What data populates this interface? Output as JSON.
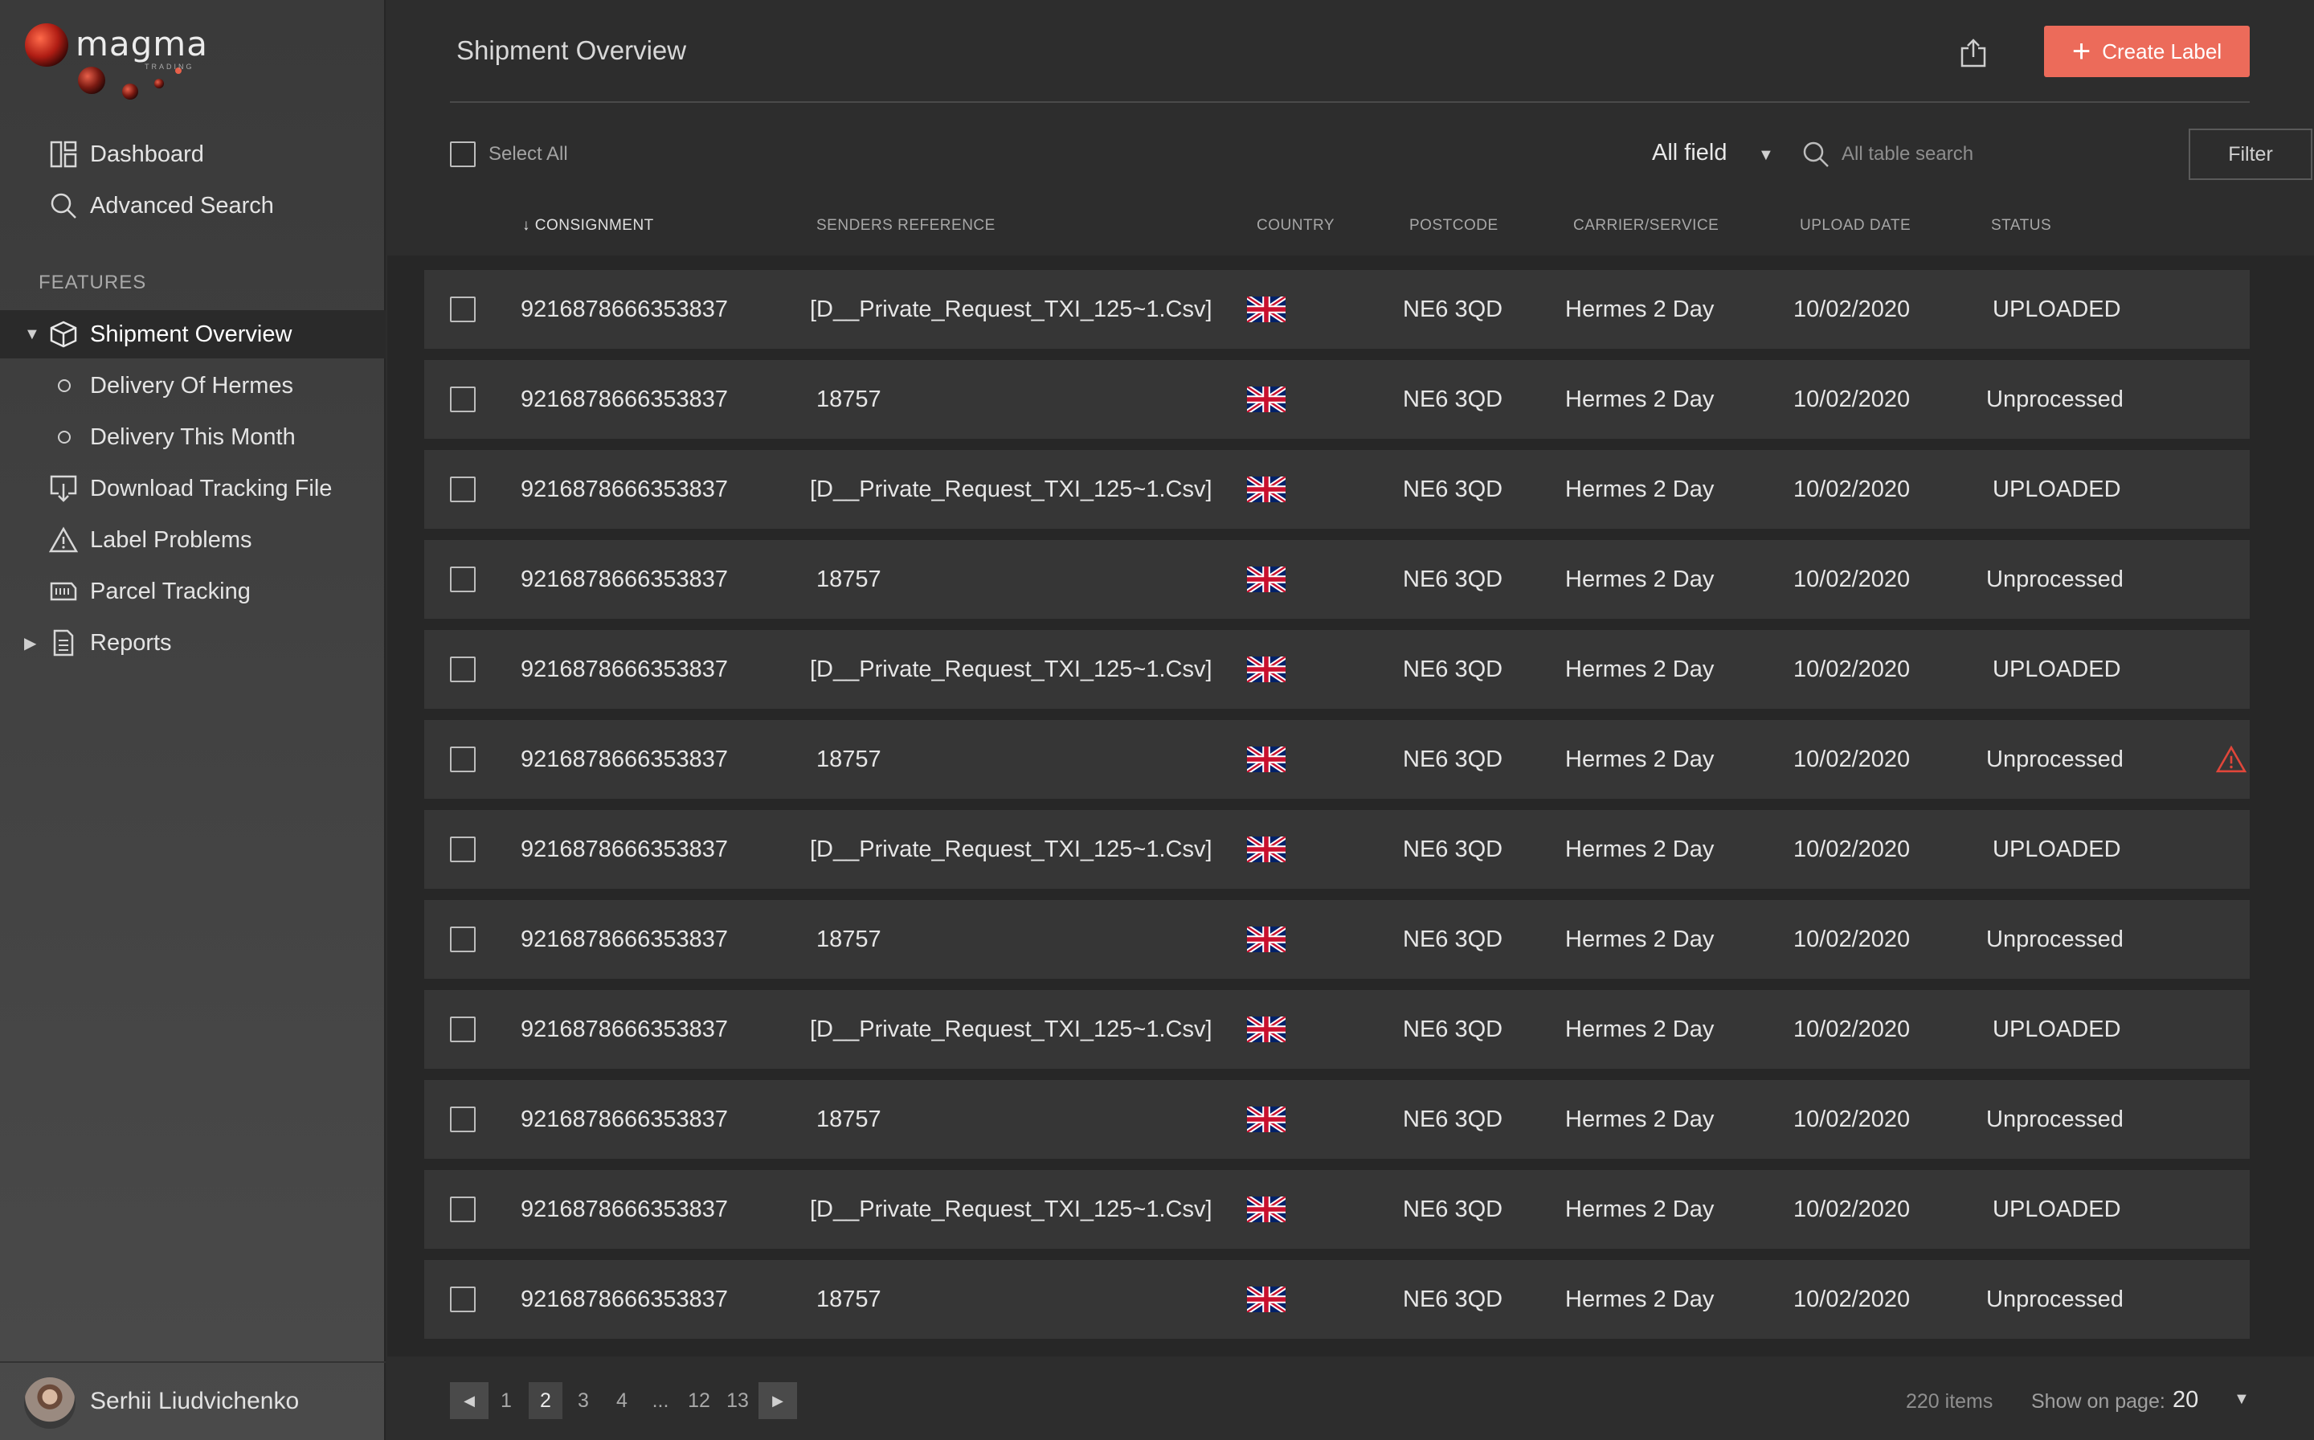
{
  "brand": {
    "name": "magma",
    "sub": "TRADING"
  },
  "sidebar": {
    "top_items": [
      {
        "label": "Dashboard",
        "icon": "dashboard-icon"
      },
      {
        "label": "Advanced Search",
        "icon": "search-icon"
      }
    ],
    "section_label": "FEATURES",
    "feature_items": [
      {
        "label": "Shipment Overview",
        "icon": "box-icon",
        "active": true
      },
      {
        "label": "Delivery Of Hermes",
        "icon": "circle-icon"
      },
      {
        "label": "Delivery This Month",
        "icon": "circle-icon"
      },
      {
        "label": "Download Tracking File",
        "icon": "download-icon"
      },
      {
        "label": "Label Problems",
        "icon": "warning-icon"
      },
      {
        "label": "Parcel Tracking",
        "icon": "barcode-icon"
      },
      {
        "label": "Reports",
        "icon": "document-icon"
      }
    ],
    "user": {
      "name": "Serhii Liudvichenko"
    }
  },
  "header": {
    "title": "Shipment Overview",
    "create_label": "Create Label"
  },
  "toolbar": {
    "select_all": "Select All",
    "field_select": "All field",
    "search_placeholder": "All table search",
    "filter": "Filter"
  },
  "table": {
    "columns": [
      "CONSIGNMENT",
      "SENDERS REFERENCE",
      "COUNTRY",
      "POSTCODE",
      "CARRIER/SERVICE",
      "UPLOAD DATE",
      "STATUS"
    ],
    "rows": [
      {
        "consignment": "9216878666353837",
        "reference": "[D__Private_Request_TXI_125~1.Csv]",
        "country": "GB",
        "postcode": "NE6 3QD",
        "carrier": "Hermes 2 Day",
        "date": "10/02/2020",
        "status": "UPLOADED",
        "warning": false
      },
      {
        "consignment": "9216878666353837",
        "reference": "18757",
        "country": "GB",
        "postcode": "NE6 3QD",
        "carrier": "Hermes 2 Day",
        "date": "10/02/2020",
        "status": "Unprocessed",
        "warning": false
      },
      {
        "consignment": "9216878666353837",
        "reference": "[D__Private_Request_TXI_125~1.Csv]",
        "country": "GB",
        "postcode": "NE6 3QD",
        "carrier": "Hermes 2 Day",
        "date": "10/02/2020",
        "status": "UPLOADED",
        "warning": false
      },
      {
        "consignment": "9216878666353837",
        "reference": "18757",
        "country": "GB",
        "postcode": "NE6 3QD",
        "carrier": "Hermes 2 Day",
        "date": "10/02/2020",
        "status": "Unprocessed",
        "warning": false
      },
      {
        "consignment": "9216878666353837",
        "reference": "[D__Private_Request_TXI_125~1.Csv]",
        "country": "GB",
        "postcode": "NE6 3QD",
        "carrier": "Hermes 2 Day",
        "date": "10/02/2020",
        "status": "UPLOADED",
        "warning": false
      },
      {
        "consignment": "9216878666353837",
        "reference": "18757",
        "country": "GB",
        "postcode": "NE6 3QD",
        "carrier": "Hermes 2 Day",
        "date": "10/02/2020",
        "status": "Unprocessed",
        "warning": true
      },
      {
        "consignment": "9216878666353837",
        "reference": "[D__Private_Request_TXI_125~1.Csv]",
        "country": "GB",
        "postcode": "NE6 3QD",
        "carrier": "Hermes 2 Day",
        "date": "10/02/2020",
        "status": "UPLOADED",
        "warning": false
      },
      {
        "consignment": "9216878666353837",
        "reference": "18757",
        "country": "GB",
        "postcode": "NE6 3QD",
        "carrier": "Hermes 2 Day",
        "date": "10/02/2020",
        "status": "Unprocessed",
        "warning": false
      },
      {
        "consignment": "9216878666353837",
        "reference": "[D__Private_Request_TXI_125~1.Csv]",
        "country": "GB",
        "postcode": "NE6 3QD",
        "carrier": "Hermes 2 Day",
        "date": "10/02/2020",
        "status": "UPLOADED",
        "warning": false
      },
      {
        "consignment": "9216878666353837",
        "reference": "18757",
        "country": "GB",
        "postcode": "NE6 3QD",
        "carrier": "Hermes 2 Day",
        "date": "10/02/2020",
        "status": "Unprocessed",
        "warning": false
      },
      {
        "consignment": "9216878666353837",
        "reference": "[D__Private_Request_TXI_125~1.Csv]",
        "country": "GB",
        "postcode": "NE6 3QD",
        "carrier": "Hermes 2 Day",
        "date": "10/02/2020",
        "status": "UPLOADED",
        "warning": false
      },
      {
        "consignment": "9216878666353837",
        "reference": "18757",
        "country": "GB",
        "postcode": "NE6 3QD",
        "carrier": "Hermes 2 Day",
        "date": "10/02/2020",
        "status": "Unprocessed",
        "warning": false
      }
    ]
  },
  "pagination": {
    "pages": [
      "1",
      "2",
      "3",
      "4",
      "...",
      "12",
      "13"
    ],
    "current": "2",
    "items": "220 items",
    "show_label": "Show on page:",
    "show_value": "20"
  },
  "colors": {
    "accent": "#ec6b5a",
    "warning": "#e0463a"
  }
}
